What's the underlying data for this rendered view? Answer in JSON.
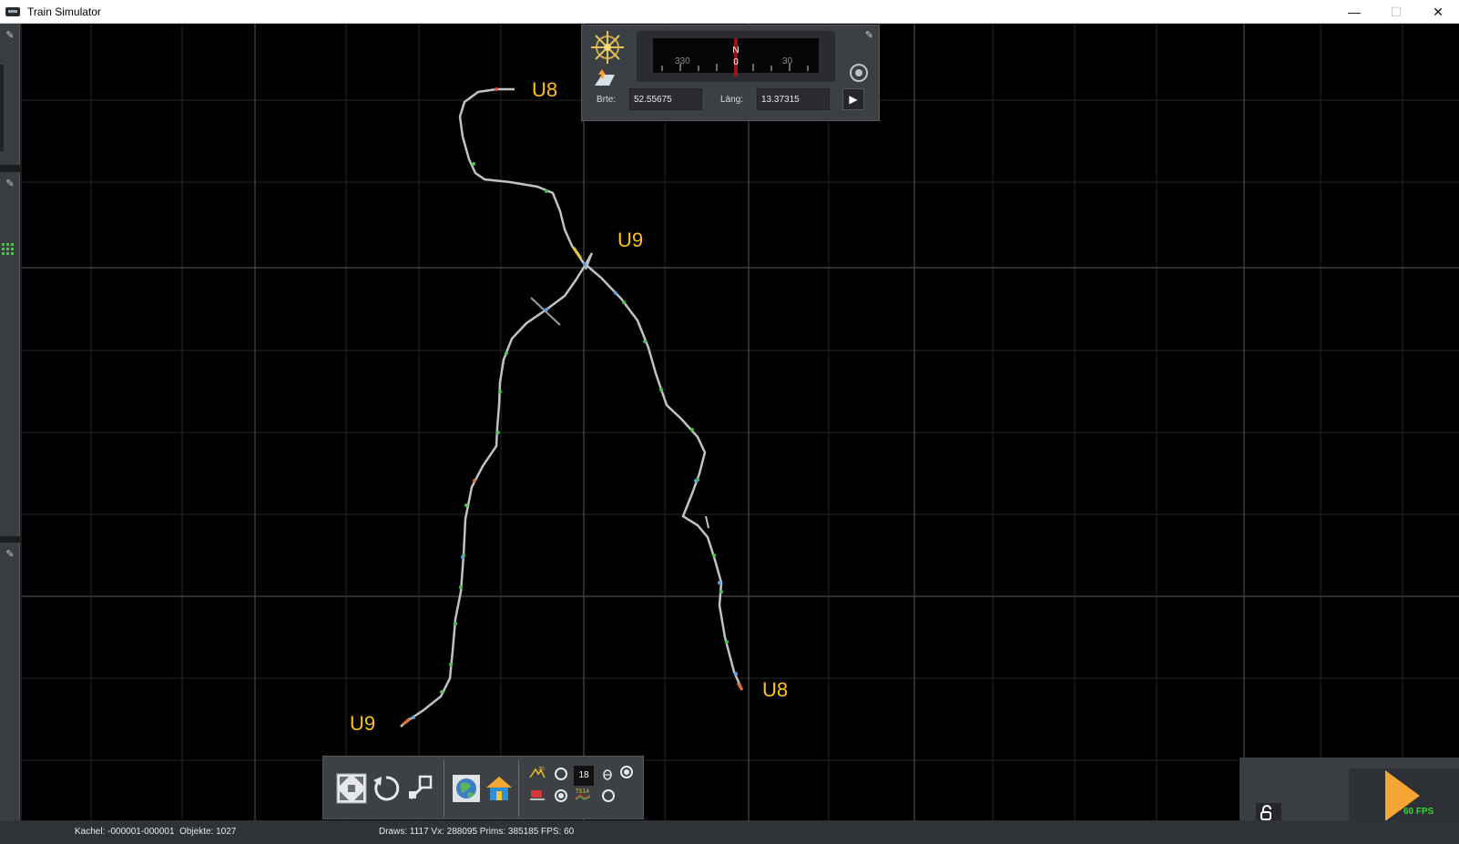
{
  "window": {
    "title": "Train Simulator",
    "minimize_glyph": "—",
    "maximize_glyph": "☐",
    "close_glyph": "✕"
  },
  "compass": {
    "north_label": "N",
    "zero_label": "0",
    "tick_left": "330",
    "tick_right": "30",
    "lat_label": "Brte:",
    "lat_value": "52.55675",
    "lon_label": "Läng:",
    "lon_value": "13.37315",
    "pin_glyph": "✎",
    "go_glyph": "▶"
  },
  "routes": [
    {
      "id": "u8-top",
      "label": "U8"
    },
    {
      "id": "u9-mid",
      "label": "U9"
    },
    {
      "id": "u9-bottom",
      "label": "U9"
    },
    {
      "id": "u8-bottom",
      "label": "U8"
    }
  ],
  "toolbar": {
    "camera_number": "18",
    "toggles": {
      "top_left_radio": false,
      "bottom_left_radio": true,
      "top_right_radio": true,
      "bottom_right_radio": false
    }
  },
  "play": {
    "fps_label": "60 FPS",
    "unlock_glyph": "🔓"
  },
  "status": {
    "tile": "Kachel: -000001-000001  Objekte: 1027",
    "stats": "Draws: 1117 Vx: 288095 Prims: 385185 FPS: 60"
  },
  "colors": {
    "track": "#bfc3c6",
    "label": "#ffc11d",
    "grid": "#2e2e2e",
    "panel": "#3c3f44"
  }
}
